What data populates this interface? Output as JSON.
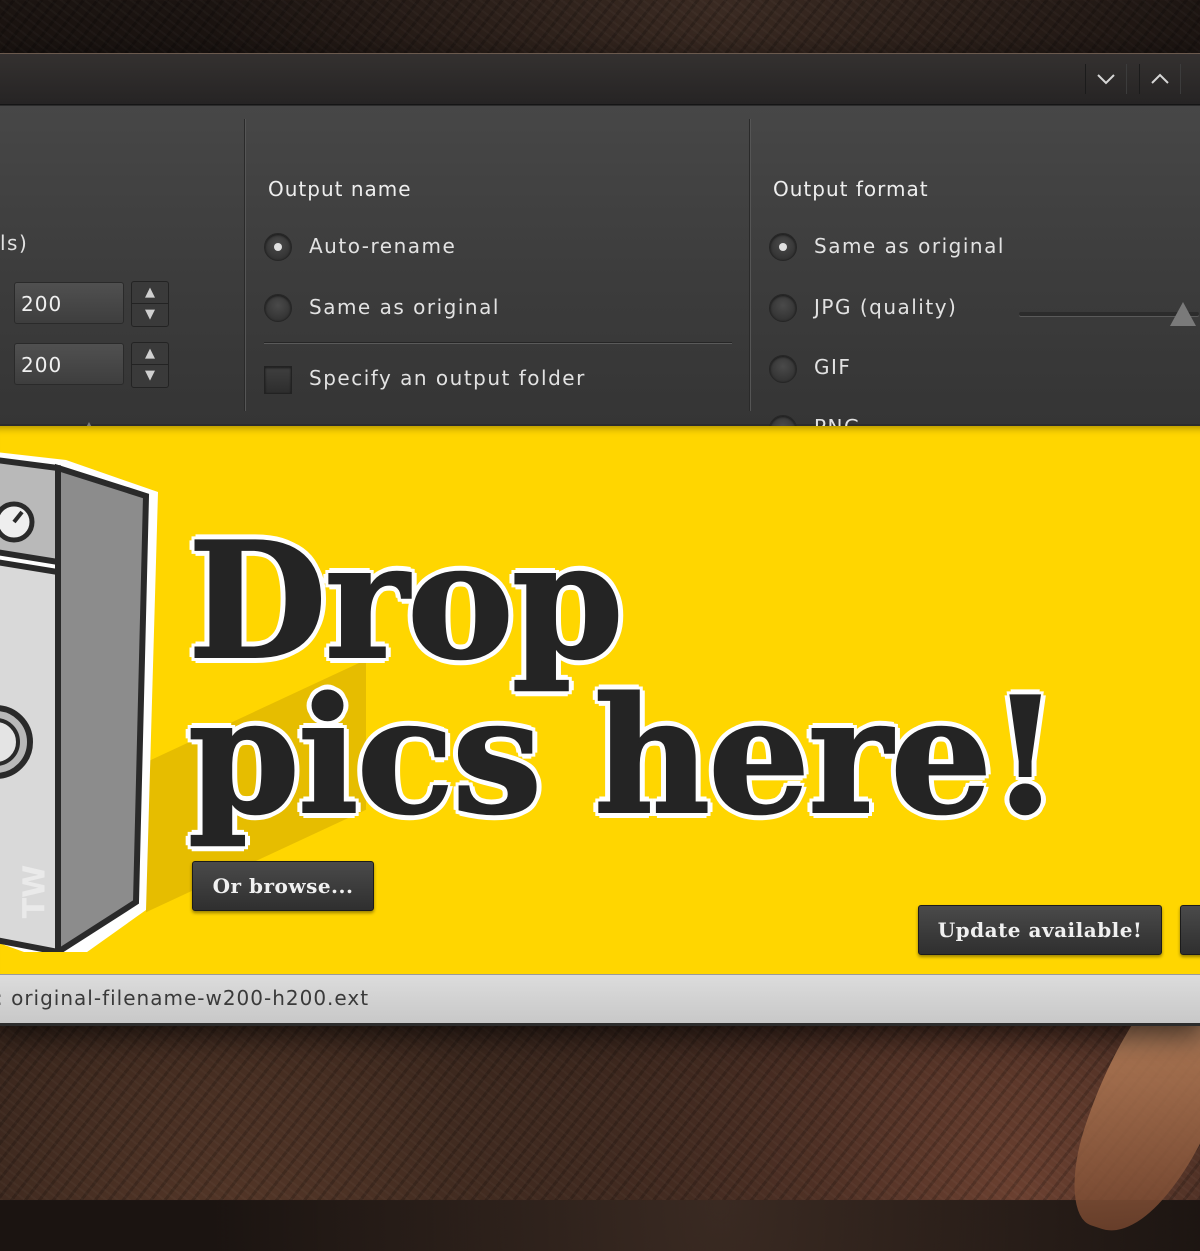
{
  "window": {
    "minimize_glyph": "⌄",
    "maximize_glyph": "⌃"
  },
  "size_group": {
    "title_fragment": "ls)",
    "width_value": "200",
    "height_value": "200"
  },
  "output_name": {
    "title": "Output name",
    "options": [
      "Auto-rename",
      "Same as original"
    ],
    "selected": "Auto-rename",
    "folder_checkbox_label": "Specify an output folder",
    "folder_checked": false
  },
  "output_format": {
    "title": "Output format",
    "options": [
      "Same as original",
      "JPG (quality)",
      "GIF",
      "PNG"
    ],
    "selected": "Same as original"
  },
  "dropzone": {
    "headline_line1": "Drop",
    "headline_line2": "pics here!",
    "browse_label": "Or browse...",
    "update_label": "Update available!",
    "logo_text": "TW"
  },
  "statusbar": {
    "text": ": original-filename-w200-h200.ext"
  },
  "colors": {
    "dropzone_bg": "#ffd600",
    "panel_bg": "#3c3c3c",
    "headline": "#242424"
  }
}
